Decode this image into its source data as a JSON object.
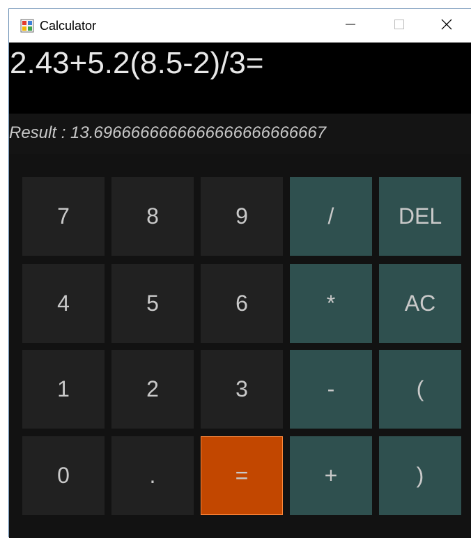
{
  "window": {
    "title": "Calculator",
    "icon": "calculator-app-icon",
    "controls": {
      "minimize": "minimize-icon",
      "maximize": "maximize-icon",
      "close": "close-icon"
    }
  },
  "display": {
    "expression": "2.43+5.2(8.5-2)/3=",
    "result": "Result : 13.6966666666666666666666667"
  },
  "keypad": {
    "row1": [
      "7",
      "8",
      "9",
      "/",
      "DEL"
    ],
    "row2": [
      "4",
      "5",
      "6",
      "*",
      "AC"
    ],
    "row3": [
      "1",
      "2",
      "3",
      "-",
      "("
    ],
    "row4": [
      "0",
      ".",
      "=",
      "+",
      ")"
    ]
  },
  "colors": {
    "expression_bg": "#000000",
    "digit_key_bg": "#212121",
    "operator_key_bg": "#2f504f",
    "equals_key_bg": "#c24700",
    "key_text": "#c9c9c9"
  }
}
